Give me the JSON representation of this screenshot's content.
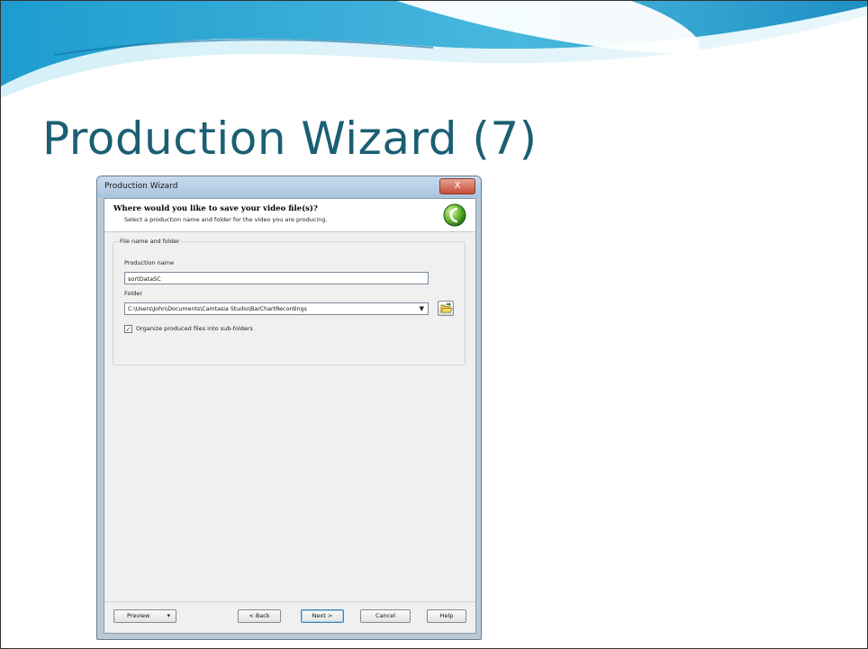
{
  "slide": {
    "title": "Production Wizard (7)"
  },
  "dialog": {
    "window_title": "Production Wizard",
    "close_glyph": "X",
    "header_title": "Where would you like to save your video file(s)?",
    "header_subtitle": "Select a production name and folder for the video you are producing.",
    "logo_icon": "camtasia-logo-icon",
    "group_label": "File name and folder",
    "production_name_label": "Production name",
    "production_name_value": "sortDataSC",
    "folder_label": "Folder",
    "folder_value": "C:\\Users\\John\\Documents\\Camtasia Studio\\BarChartRecordings",
    "browse_icon": "folder-open-icon",
    "organize_checked": true,
    "organize_check_glyph": "✓",
    "organize_label": "Organize produced files into sub-folders",
    "buttons": {
      "preview": "Preview",
      "back": "< Back",
      "next": "Next >",
      "cancel": "Cancel",
      "help": "Help"
    }
  },
  "colors": {
    "title_color": "#1b5f73",
    "banner_blue": "#1d94c9",
    "banner_light": "#bfe6f3"
  }
}
